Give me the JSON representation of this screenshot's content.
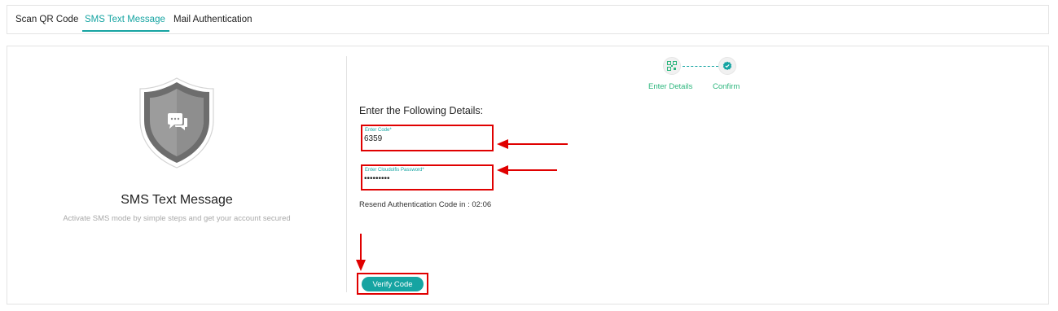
{
  "tabs": [
    {
      "label": "Scan QR Code"
    },
    {
      "label": "SMS Text Message"
    },
    {
      "label": "Mail Authentication"
    }
  ],
  "left_panel": {
    "title": "SMS Text Message",
    "subtitle": "Activate SMS mode by simple steps and get your account secured",
    "icon": "shield-chat-icon"
  },
  "steps": [
    {
      "label": "Enter Details",
      "icon": "qr-code-icon"
    },
    {
      "label": "Confirm",
      "icon": "check-badge-icon"
    }
  ],
  "form": {
    "heading": "Enter the Following Details:",
    "code_label": "Enter Code*",
    "code_value": "6359",
    "password_label": "Enter Cloudolfis Password*",
    "password_value": "•••••••••",
    "resend_text": "Resend Authentication Code in : 02:06",
    "verify_label": "Verify Code"
  },
  "colors": {
    "accent": "#16a4a2",
    "step_label": "#2cb67d",
    "annotation": "#e00000"
  }
}
